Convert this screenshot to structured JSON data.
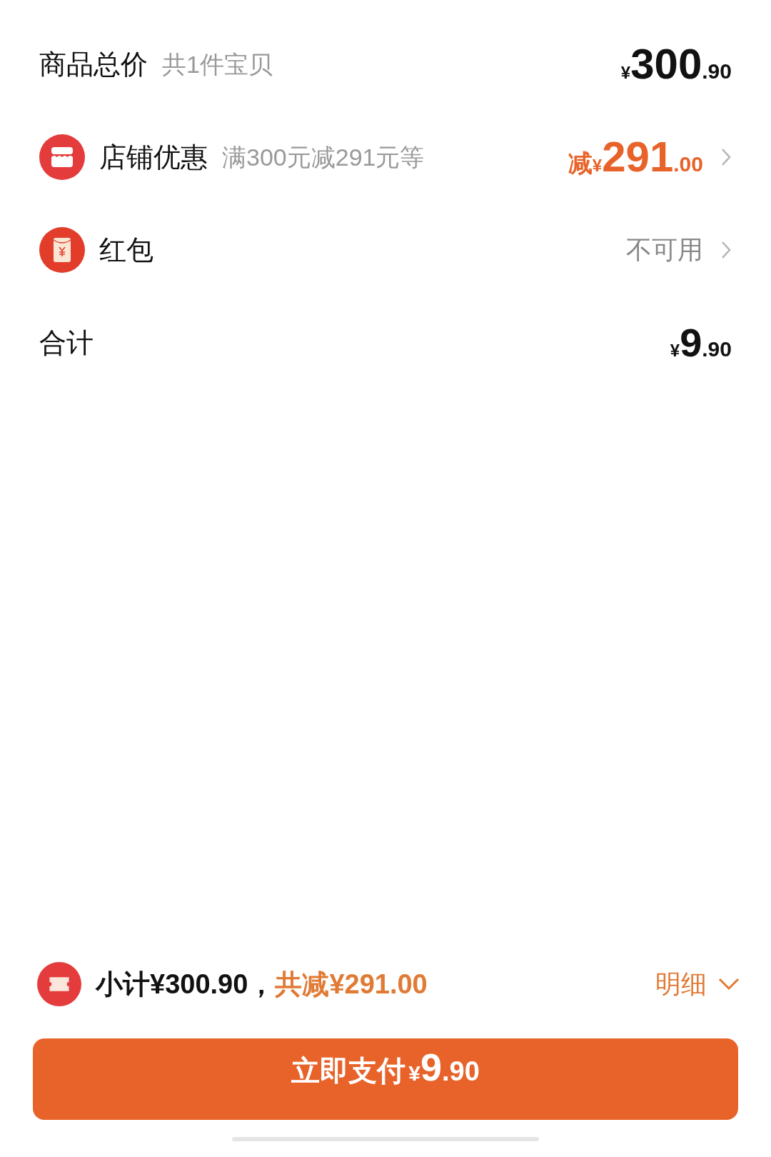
{
  "rows": [
    {
      "kind": "total",
      "label": "商品总价",
      "hint": "共1件宝贝",
      "price": {
        "currency": "¥",
        "integer": "300",
        "decimal": ".90"
      }
    },
    {
      "kind": "shop_discount",
      "label": "店铺优惠",
      "hint": "满300元减291元等",
      "price": {
        "prefix": "减",
        "currency": "¥",
        "integer": "291",
        "decimal": ".00"
      },
      "chevron": true
    },
    {
      "kind": "red_packet",
      "label": "红包",
      "status": "不可用",
      "chevron": true
    },
    {
      "kind": "sum",
      "label": "合计",
      "price": {
        "currency": "¥",
        "integer": "9",
        "decimal": ".90"
      }
    }
  ],
  "summary": {
    "subtotal": "小计¥300.90，",
    "discount": "共减¥291.00",
    "details": "明细"
  },
  "pay_button": {
    "label": "立即支付",
    "currency": "¥",
    "integer": "9",
    "decimal": ".90"
  }
}
